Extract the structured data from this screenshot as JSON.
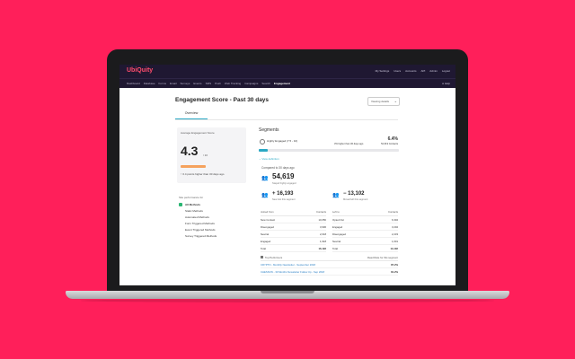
{
  "app": {
    "logo": "UbiQuity"
  },
  "topbar": {
    "links": [
      "My Settings",
      "Users",
      "Accounts",
      "API",
      "Admin",
      "Logout"
    ],
    "help": "● Help"
  },
  "nav": {
    "items": [
      "Dashboard",
      "Database",
      "Forms",
      "Email",
      "Surveys",
      "Events",
      "SMS",
      "Push",
      "Web Tracking",
      "Campaigns",
      "Search",
      "Engagement"
    ],
    "active_index": 11
  },
  "page": {
    "title": "Engagement Score - Past 30 days",
    "dropdown_value": "Viewing details",
    "tab": "Overview"
  },
  "score_card": {
    "label": "Average Engagement Score",
    "score": "4.3",
    "denominator": "/ 10",
    "bar_fraction": 0.43,
    "change": "0.4 points higher than 30 days ago"
  },
  "performance": {
    "label": "Site performance for",
    "items": [
      "All Methods",
      "Static Methods",
      "Automated Methods",
      "Form Triggered Methods",
      "Event Triggered Methods",
      "Survey Triggered Methods"
    ],
    "checked_index": 0
  },
  "segments": {
    "title": "Segments",
    "row": {
      "name": "Highly Engaged (7.5 - 10)",
      "pct": "6.4%",
      "note": "3% higher than 30 days ago",
      "contacts": "54,619 Contacts",
      "fill_fraction": 0.064
    },
    "view_definition": "View definition",
    "compared": "Compared to 30 days ago",
    "big": {
      "value": "54,619",
      "sub": "Stayed highly engaged"
    },
    "left": {
      "value": "16,193",
      "sub": "New into this segment"
    },
    "right": {
      "value": "13,102",
      "sub": "Moved left this segment"
    },
    "table_left": {
      "headers": [
        "Joined from",
        "Contacts"
      ],
      "rows": [
        [
          "New Contact",
          "10,056"
        ],
        [
          "Disengaged",
          "3,900"
        ],
        [
          "Neutral",
          "2,018"
        ],
        [
          "Engaged",
          "1,918"
        ],
        [
          "Total",
          "16,193"
        ]
      ]
    },
    "table_right": {
      "headers": [
        "Left to",
        "Contacts"
      ],
      "rows": [
        [
          "Opted Out",
          "6,302"
        ],
        [
          "Engaged",
          "3,202"
        ],
        [
          "Disengaged",
          "2,233"
        ],
        [
          "Neutral",
          "1,601"
        ],
        [
          "Total",
          "13,102"
        ]
      ]
    }
  },
  "top_performers": {
    "label": "Top Performers",
    "right_label": "Read Rate for this segment",
    "rows": [
      [
        "CRYPTO - Monthly Newsletter - September 2018",
        "87.2%"
      ],
      [
        "CHESSON - 30 Months Newsletter Follow Up - Sep 2018",
        "81.2%"
      ]
    ]
  }
}
